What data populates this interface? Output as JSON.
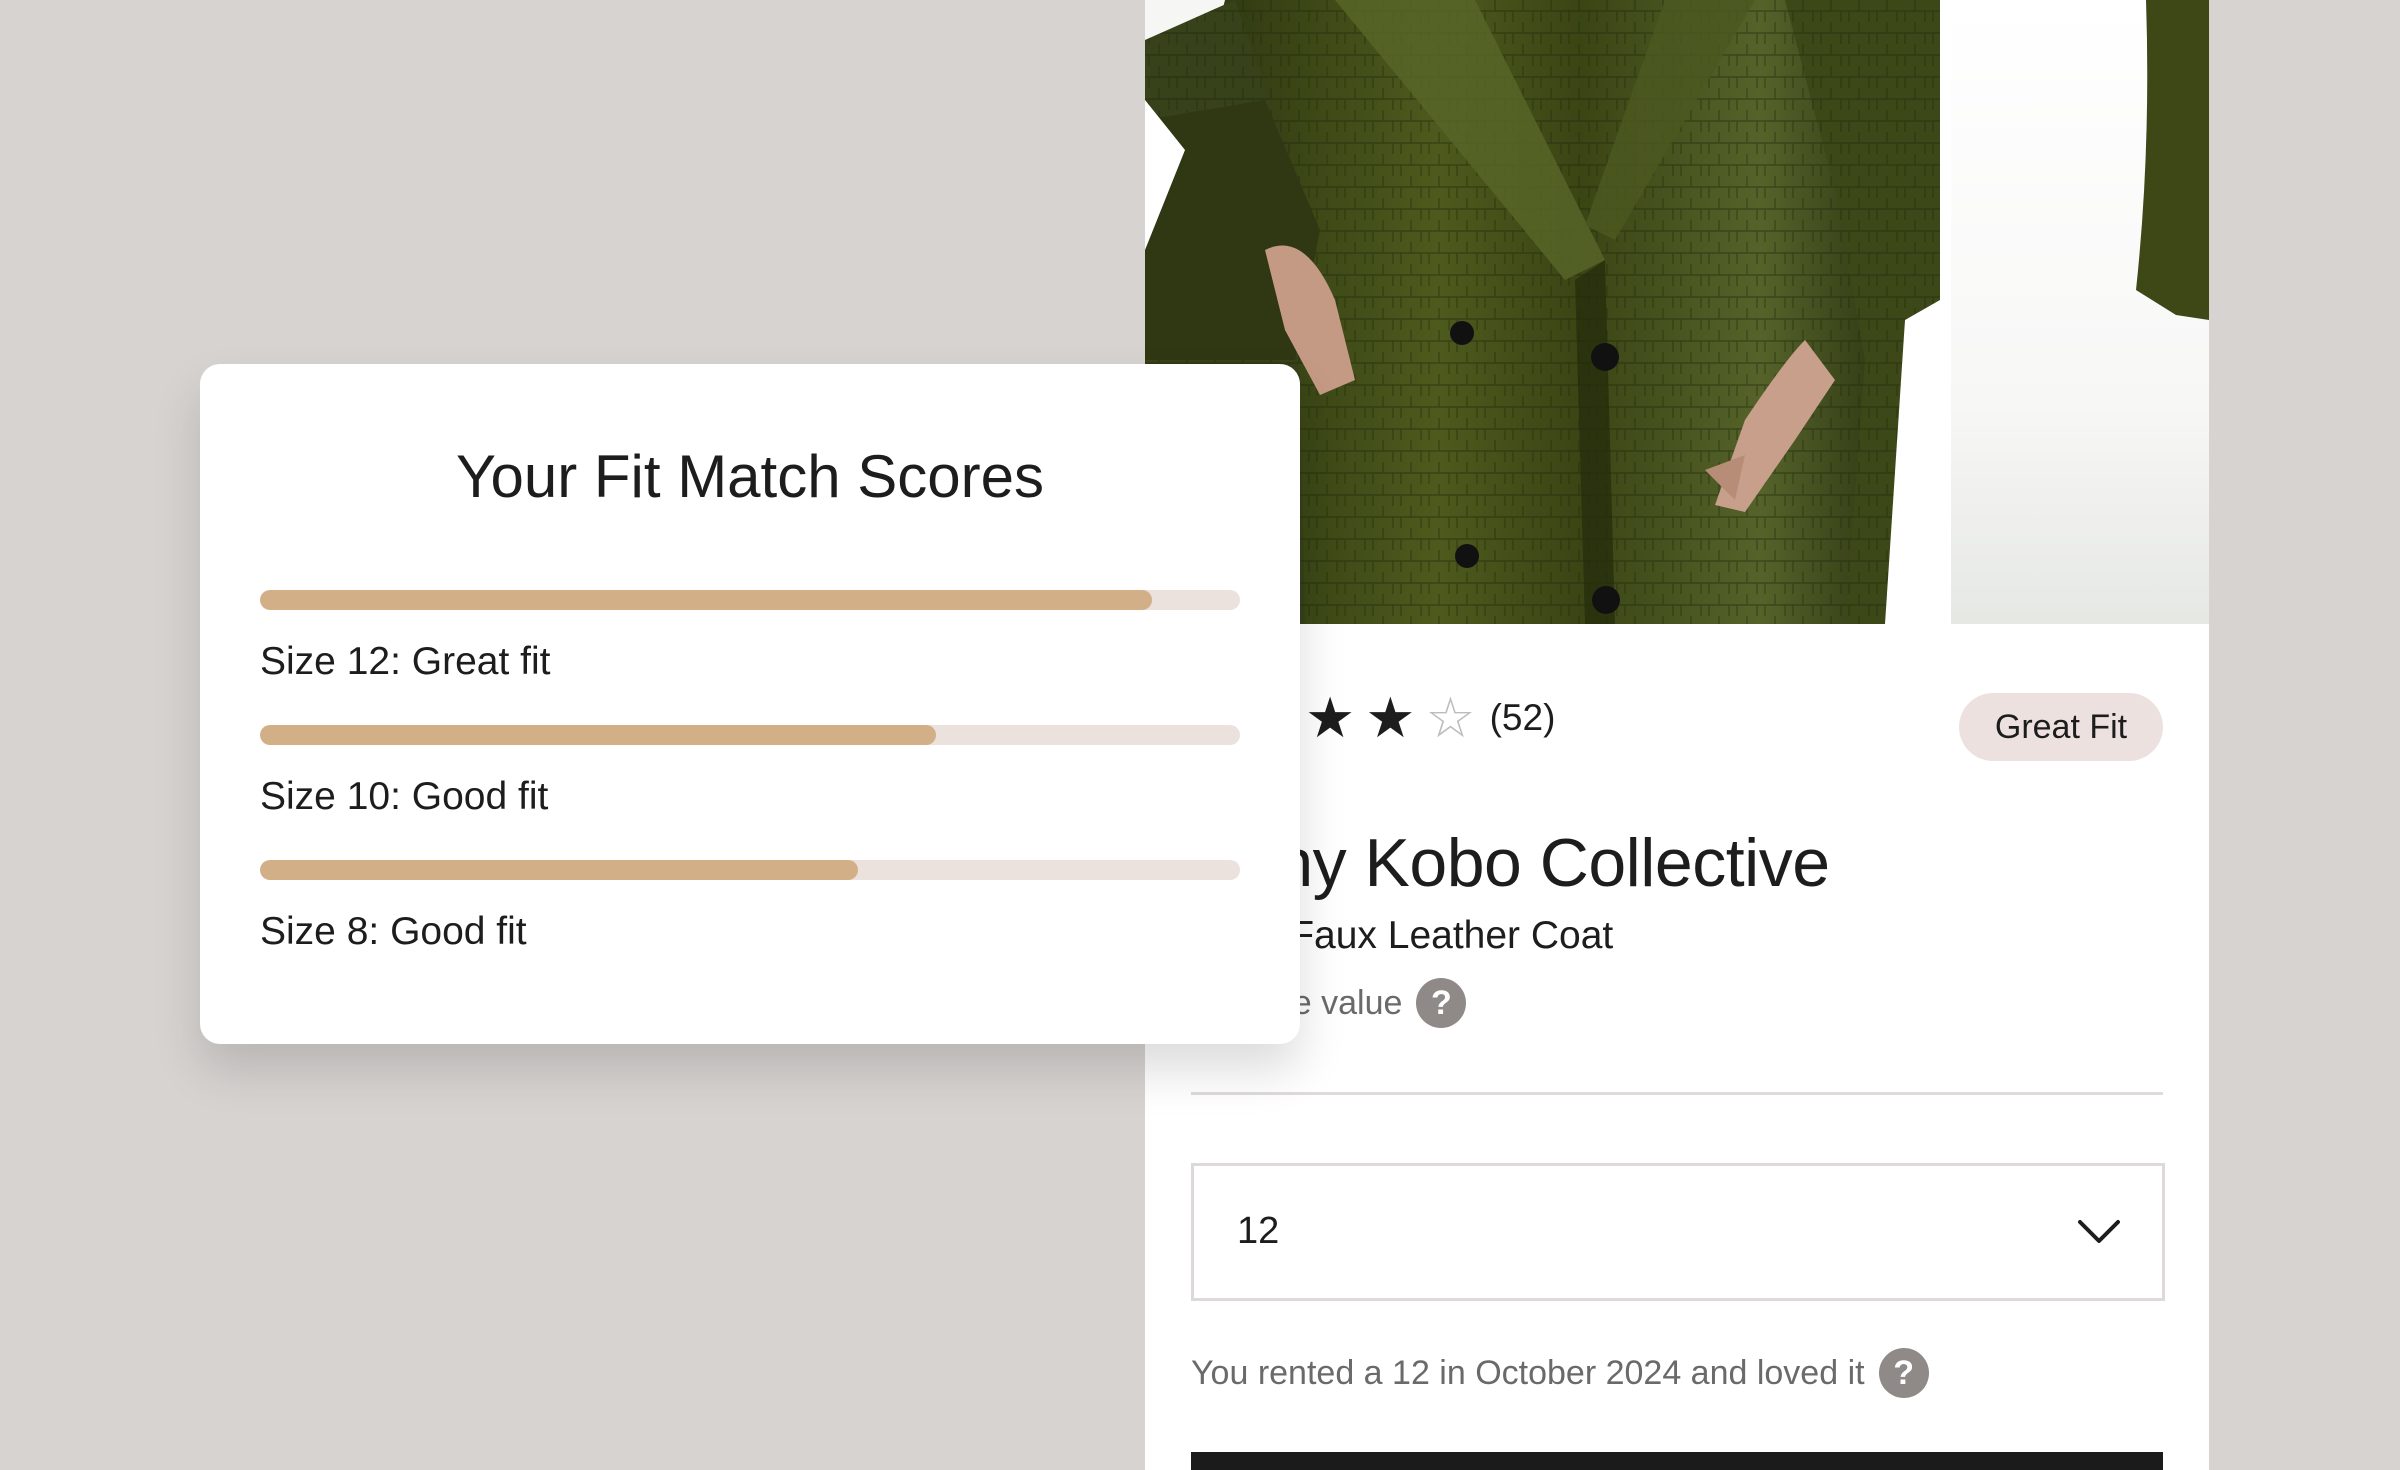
{
  "fit_card": {
    "title": "Your Fit Match Scores",
    "rows": [
      {
        "label": "Size 12: Great fit",
        "score": 0.91
      },
      {
        "label": "Size 10: Good fit",
        "score": 0.69
      },
      {
        "label": "Size 8: Good fit",
        "score": 0.61
      }
    ]
  },
  "product": {
    "rating": {
      "filled_stars": 2,
      "empty_stars": 1,
      "count": "(52)"
    },
    "badge": "Great Fit",
    "brand": "any Kobo Collective",
    "name": "ssed Faux Leather Coat",
    "value_note": "omparable value",
    "help_glyph": "?",
    "size_select": {
      "value": "12"
    },
    "rented_note": "You rented a 12 in October 2024 and loved it"
  },
  "colors": {
    "background": "#d7d3d1",
    "bar_fill": "#d2af87",
    "bar_track": "#ebe1dd",
    "badge": "#ece1de",
    "coat": "#3f4a17"
  },
  "icons": {
    "star": "star-icon",
    "help": "help-icon",
    "chevron": "chevron-down-icon"
  }
}
